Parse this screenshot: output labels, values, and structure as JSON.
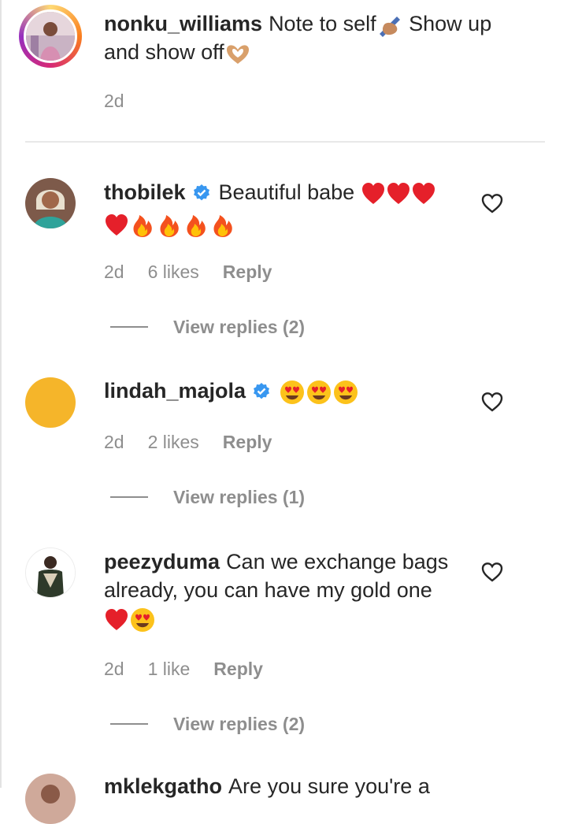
{
  "caption": {
    "username": "nonku_williams",
    "text_before": "Note to self",
    "text_middle": " Show up and show off",
    "time": "2d"
  },
  "comments": [
    {
      "username": "thobilek",
      "verified": true,
      "text": "Beautiful babe",
      "emojis": [
        "red-heart",
        "red-heart",
        "red-heart",
        "red-heart",
        "fire",
        "fire",
        "fire",
        "fire"
      ],
      "time": "2d",
      "likes": "6 likes",
      "reply_label": "Reply",
      "view_replies": "View replies (2)"
    },
    {
      "username": "lindah_majola",
      "verified": true,
      "text": "",
      "emojis": [
        "heart-eyes",
        "heart-eyes",
        "heart-eyes"
      ],
      "time": "2d",
      "likes": "2 likes",
      "reply_label": "Reply",
      "view_replies": "View replies (1)"
    },
    {
      "username": "peezyduma",
      "verified": false,
      "text": "Can we exchange bags already, you can have my gold one",
      "emojis": [
        "red-heart",
        "heart-eyes"
      ],
      "time": "2d",
      "likes": "1 like",
      "reply_label": "Reply",
      "view_replies": "View replies (2)"
    },
    {
      "username": "mklekgatho",
      "text": "Are you sure you're a"
    }
  ],
  "colors": {
    "text": "#262626",
    "secondary": "#8e8e8e",
    "verified": "#3897f0",
    "story_ring_start": "#feda75",
    "story_ring_end": "#d62976",
    "avatar_yellow": "#f5b52a"
  }
}
